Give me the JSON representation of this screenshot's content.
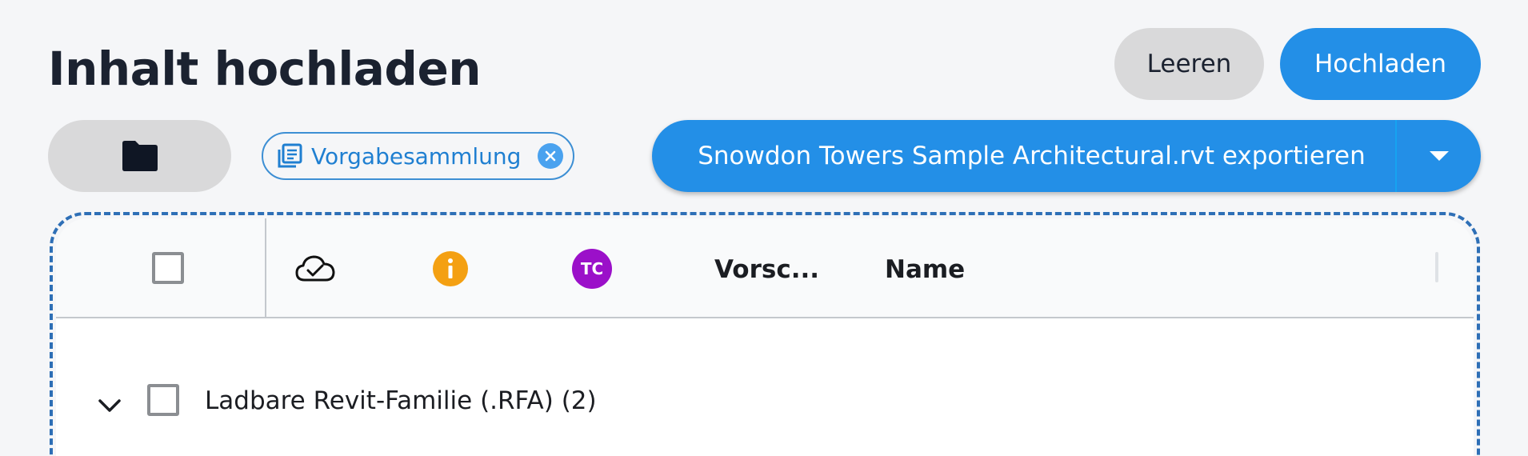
{
  "header": {
    "title": "Inhalt hochladen",
    "clear_label": "Leeren",
    "upload_label": "Hochladen"
  },
  "toolbar": {
    "folder_icon": "folder-icon",
    "chip_label": "Vorgabesammlung",
    "export_label": "Snowdon Towers Sample Architectural.rvt exportieren"
  },
  "table": {
    "columns": {
      "cloud": "cloud-check-icon",
      "info": "info-icon",
      "tc_badge": "TC",
      "preview": "Vorsc...",
      "name": "Name"
    },
    "groups": [
      {
        "label": "Ladbare Revit-Familie (.RFA) (2)",
        "expanded": true
      }
    ]
  },
  "colors": {
    "primary": "#238fe7",
    "secondary": "#d9d9da",
    "info_badge": "#f4a012",
    "tc_badge": "#9b10c9",
    "dropzone_border": "#2e6fb6"
  }
}
